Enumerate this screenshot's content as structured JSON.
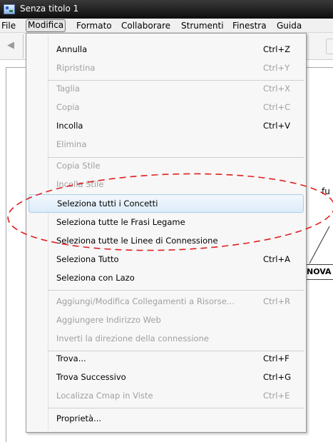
{
  "window": {
    "title": "Senza titolo 1"
  },
  "menubar": {
    "items": [
      "File",
      "Modifica",
      "Formato",
      "Collaborare",
      "Strumenti",
      "Finestra",
      "Guida"
    ]
  },
  "canvas": {
    "fragment_text": "fu",
    "concept_text": "NOVA"
  },
  "menu": {
    "items": [
      {
        "label": "Annulla",
        "shortcut": "Ctrl+Z",
        "enabled": true
      },
      {
        "label": "Ripristina",
        "shortcut": "Ctrl+Y",
        "enabled": false
      },
      {
        "label": "Taglia",
        "shortcut": "Ctrl+X",
        "enabled": false
      },
      {
        "label": "Copia",
        "shortcut": "Ctrl+C",
        "enabled": false
      },
      {
        "label": "Incolla",
        "shortcut": "Ctrl+V",
        "enabled": true
      },
      {
        "label": "Elimina",
        "shortcut": "",
        "enabled": false
      },
      {
        "label": "Copia Stile",
        "shortcut": "",
        "enabled": false
      },
      {
        "label": "Incolla Stile",
        "shortcut": "",
        "enabled": false
      },
      {
        "label": "Seleziona tutti i Concetti",
        "shortcut": "",
        "enabled": true,
        "hovered": true
      },
      {
        "label": "Seleziona tutte le Frasi Legame",
        "shortcut": "",
        "enabled": true
      },
      {
        "label": "Seleziona tutte le Linee di Connessione",
        "shortcut": "",
        "enabled": true
      },
      {
        "label": "Seleziona Tutto",
        "shortcut": "Ctrl+A",
        "enabled": true
      },
      {
        "label": "Seleziona con Lazo",
        "shortcut": "",
        "enabled": true
      },
      {
        "label": "Aggiungi/Modifica Collegamenti a Risorse...",
        "shortcut": "Ctrl+R",
        "enabled": false
      },
      {
        "label": "Aggiungere Indirizzo Web",
        "shortcut": "",
        "enabled": false
      },
      {
        "label": "Inverti la direzione della connessione",
        "shortcut": "",
        "enabled": false
      },
      {
        "label": "Trova...",
        "shortcut": "Ctrl+F",
        "enabled": true
      },
      {
        "label": "Trova Successivo",
        "shortcut": "Ctrl+G",
        "enabled": true
      },
      {
        "label": "Localizza Cmap in Viste",
        "shortcut": "Ctrl+E",
        "enabled": false
      },
      {
        "label": "Proprietà...",
        "shortcut": "",
        "enabled": true
      }
    ]
  },
  "colors": {
    "annotation": "#e02020",
    "hover_fill": "#dcebfa",
    "disabled_text": "#a0a0a0"
  },
  "icons": {
    "app": "cmap-app-icon",
    "back": "back-arrow-icon"
  }
}
